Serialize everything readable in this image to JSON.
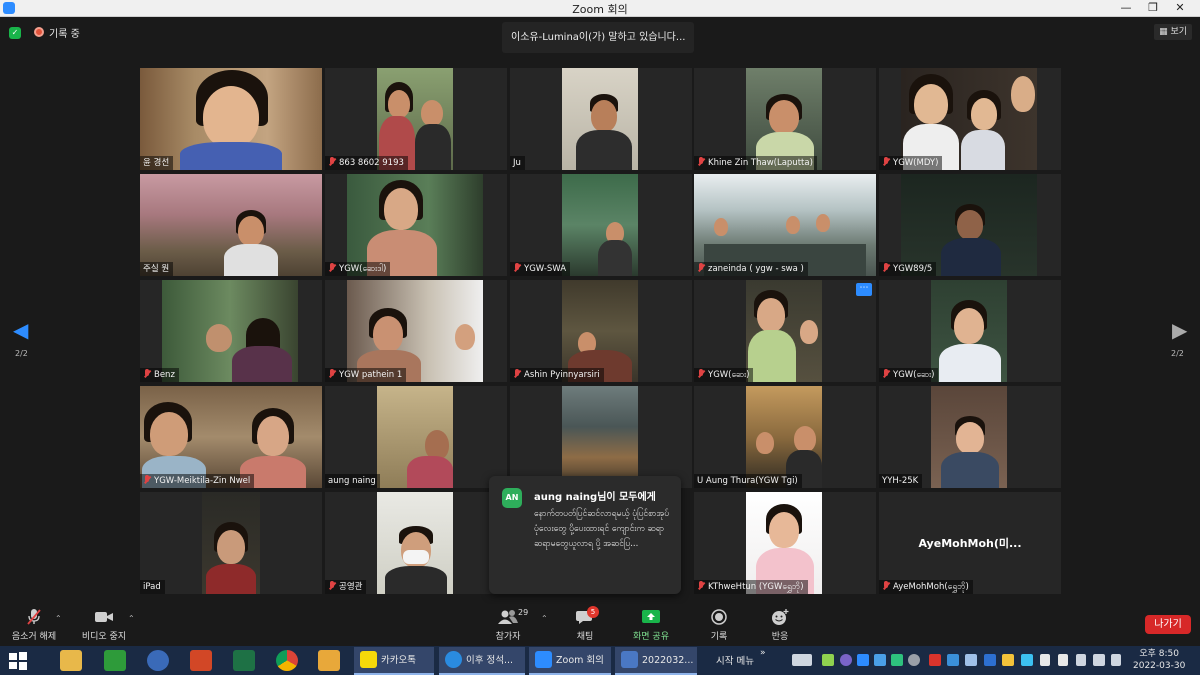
{
  "window": {
    "title": "Zoom 회의"
  },
  "topbar": {
    "recording_label": "기록 중",
    "speaking_notice": "이소유-Lumina이(가) 말하고 있습니다...",
    "view_button": "보기"
  },
  "pager": {
    "left": "2/2",
    "right": "2/2"
  },
  "participants": [
    {
      "name": "윤 경선",
      "muted": false
    },
    {
      "name": "863 8602 9193",
      "muted": true
    },
    {
      "name": "Ju",
      "muted": false
    },
    {
      "name": "Khine Zin Thaw(Laputta)",
      "muted": true
    },
    {
      "name": "YGW(MDY)",
      "muted": true
    },
    {
      "name": "주실 원",
      "muted": true
    },
    {
      "name": "YGW(ဆေးဒါ)",
      "muted": true
    },
    {
      "name": "YGW-SWA",
      "muted": true
    },
    {
      "name": "zaneinda ( ygw - swa )",
      "muted": true
    },
    {
      "name": "YGW89/5",
      "muted": true
    },
    {
      "name": "Benz",
      "muted": true
    },
    {
      "name": "YGW pathein 1",
      "muted": true
    },
    {
      "name": "Ashin Pyinnyarsiri",
      "muted": true
    },
    {
      "name": "YGW(ဆေး)",
      "muted": true
    },
    {
      "name": "YGW(ဆေး)",
      "muted": true
    },
    {
      "name": "YGW-Meiktila-Zin Nwel",
      "muted": true
    },
    {
      "name": "aung naing",
      "muted": false
    },
    {
      "name": "",
      "muted": false
    },
    {
      "name": "U Aung Thura(YGW Tgi)",
      "muted": false
    },
    {
      "name": "YYH-25K",
      "muted": false
    },
    {
      "name": "iPad",
      "muted": false
    },
    {
      "name": "공영관",
      "muted": true
    },
    {
      "name": "",
      "muted": false
    },
    {
      "name": "KThweHtun (YGWရွှေဘို)",
      "muted": true
    },
    {
      "name": "AyeMohMoh(ရွှေဘို)",
      "muted": true,
      "video_off_label": "AyeMohMoh(미..."
    }
  ],
  "chat_popup": {
    "avatar": "AN",
    "from": "aung naing님이 모두에게",
    "message": "နောက်တပတ်ပြင်ဆင်လာရမယ့် ပုံပြင်စာအုပ် ပုံလေးတွေ ပို့ပေးထားရင် ကျောင်းက ဆရာဆရာမတွေယူလာရ ပို့ အဆင်ပြ..."
  },
  "toolbar": {
    "unmute": "음소거 해제",
    "stop_video": "비디오 중지",
    "participants": "참가자",
    "participants_count": "29",
    "chat": "채팅",
    "chat_badge": "5",
    "share_screen": "화면 공유",
    "record": "기록",
    "reactions": "반응",
    "leave": "나가기"
  },
  "taskbar": {
    "kakao": "카카오톡",
    "ie": "이후 정석...",
    "zoom": "Zoom 회의",
    "app": "2022032...",
    "start_menu": "시작 메뉴",
    "clock_time": "오후 8:50",
    "clock_date": "2022-03-30"
  },
  "colors": {
    "zoom_blue": "#2d8cff",
    "share_green": "#19b44a",
    "leave_red": "#d72828",
    "mute_red": "#e04343",
    "taskbar": "#1a2a44"
  }
}
